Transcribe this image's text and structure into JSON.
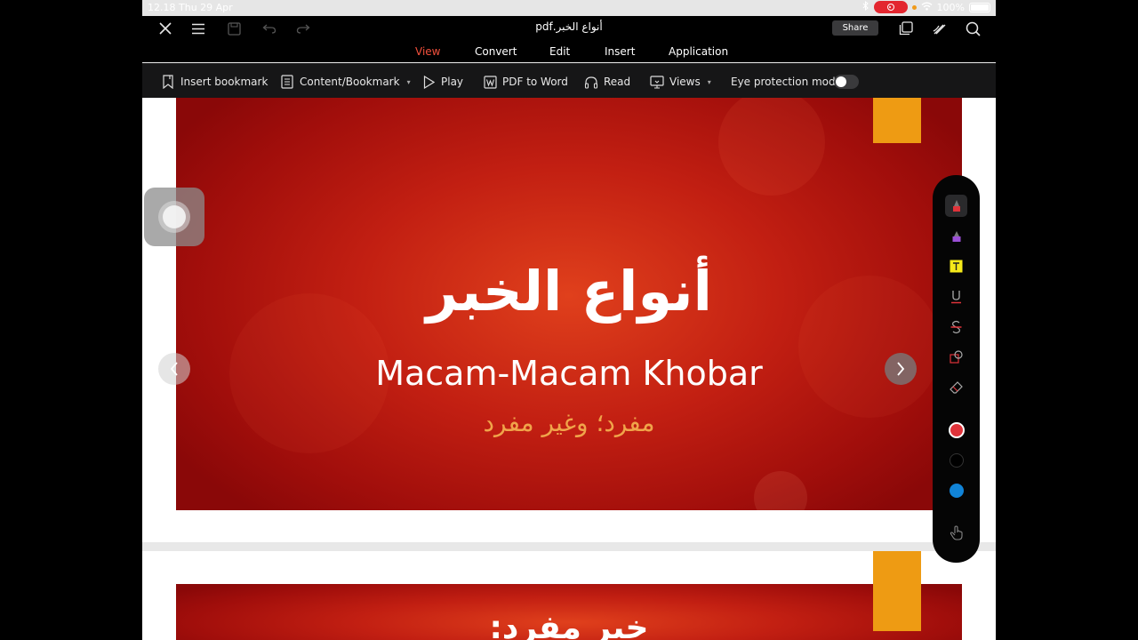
{
  "status_bar": {
    "time": "12.18",
    "date": "Thu 29 Apr",
    "battery": "100%"
  },
  "title_bar": {
    "document_title": "أنواع الخبر.pdf",
    "share_label": "Share"
  },
  "menu": {
    "tabs": [
      {
        "label": "View",
        "active": true
      },
      {
        "label": "Convert",
        "active": false
      },
      {
        "label": "Edit",
        "active": false
      },
      {
        "label": "Insert",
        "active": false
      },
      {
        "label": "Application",
        "active": false
      }
    ]
  },
  "toolbar": {
    "insert_bookmark": "Insert bookmark",
    "content_bookmark": "Content/Bookmark",
    "play": "Play",
    "pdf_to_word": "PDF to Word",
    "read": "Read",
    "views": "Views",
    "eye_protection": "Eye protection mode"
  },
  "slides": [
    {
      "arabic_title": "أنواع الخبر",
      "latin_title": "Macam-Macam Khobar",
      "arabic_subtitle": "مفرد؛ وغير مفرد"
    },
    {
      "arabic_title": "خبر مفرد:"
    }
  ],
  "colors": {
    "accent": "#f2503c",
    "slide_red": "#c21f12",
    "slide_orange": "#ee9b13",
    "subtitle_gold": "#f0a44a"
  },
  "palette": {
    "tools": [
      "red-pen-icon",
      "purple-highlighter-icon",
      "text-box-icon",
      "underline-icon",
      "strikethrough-icon",
      "shape-icon",
      "eraser-icon"
    ],
    "colors": [
      "#e0333a",
      "#000000",
      "#1184d8"
    ],
    "finger_icon": "hand-pointer-icon"
  }
}
